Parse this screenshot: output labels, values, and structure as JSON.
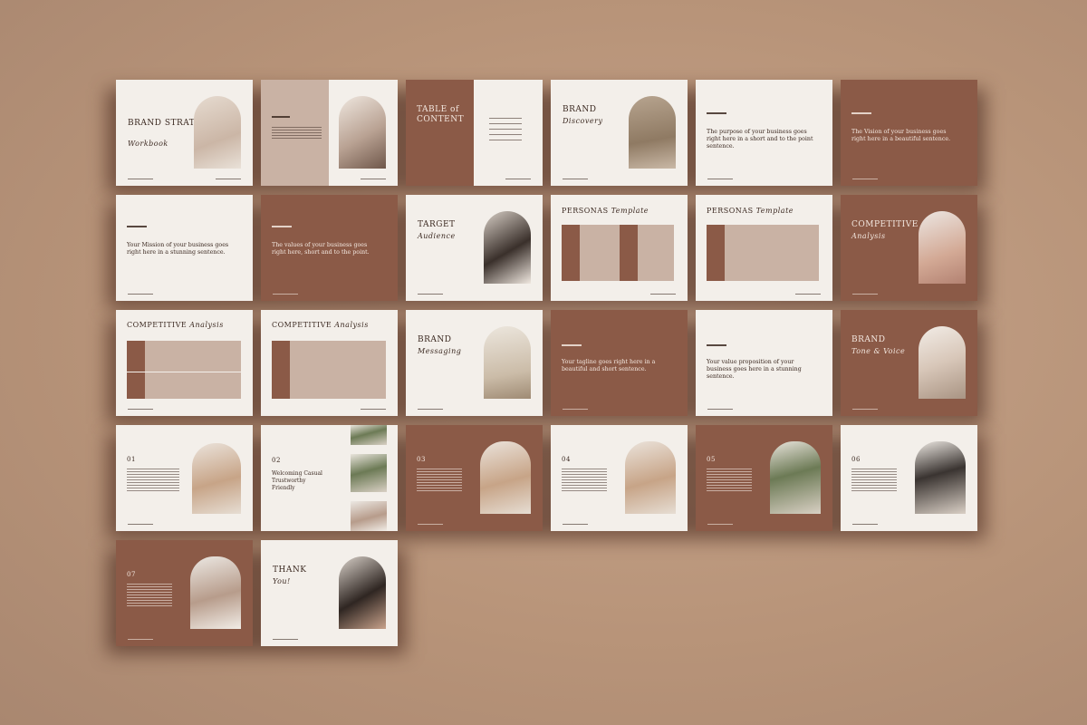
{
  "background_color": "#b89479",
  "slides": [
    {
      "id": 1,
      "title": "BRAND STRATEGY",
      "subtitle": "Workbook"
    },
    {
      "id": 2,
      "title": "",
      "subtitle": ""
    },
    {
      "id": 3,
      "title": "TABLE of CONTENT",
      "subtitle": ""
    },
    {
      "id": 4,
      "title": "BRAND",
      "subtitle": "Discovery"
    },
    {
      "id": 5,
      "title": "",
      "body": "The purpose of your business goes right here in a short and to the point sentence."
    },
    {
      "id": 6,
      "title": "",
      "body": "The Vision of your business goes right here in a beautiful sentence."
    },
    {
      "id": 7,
      "title": "",
      "body": "Your Mission of your business goes right here in a stunning sentence."
    },
    {
      "id": 8,
      "title": "",
      "body": "The values of your business goes right here, short and to the point."
    },
    {
      "id": 9,
      "title": "TARGET",
      "subtitle": "Audience"
    },
    {
      "id": 10,
      "title": "PERSONAS",
      "subtitle": "Template"
    },
    {
      "id": 11,
      "title": "PERSONAS",
      "subtitle": "Template"
    },
    {
      "id": 12,
      "title": "COMPETITIVE",
      "subtitle": "Analysis"
    },
    {
      "id": 13,
      "title": "COMPETITIVE",
      "subtitle": "Analysis"
    },
    {
      "id": 14,
      "title": "COMPETITIVE",
      "subtitle": "Analysis"
    },
    {
      "id": 15,
      "title": "BRAND",
      "subtitle": "Messaging"
    },
    {
      "id": 16,
      "title": "",
      "body": "Your tagline goes right here in a beautiful and short sentence."
    },
    {
      "id": 17,
      "title": "",
      "body": "Your value proposition of your business goes here in a stunning sentence."
    },
    {
      "id": 18,
      "title": "BRAND",
      "subtitle": "Tone & Voice"
    },
    {
      "id": 19,
      "title": "01",
      "subtitle": ""
    },
    {
      "id": 20,
      "title": "02",
      "body": "Welcoming Casual Trustworthy Friendly"
    },
    {
      "id": 21,
      "title": "03",
      "subtitle": ""
    },
    {
      "id": 22,
      "title": "04",
      "subtitle": ""
    },
    {
      "id": 23,
      "title": "05",
      "subtitle": ""
    },
    {
      "id": 24,
      "title": "06",
      "subtitle": ""
    },
    {
      "id": 25,
      "title": "07",
      "subtitle": ""
    },
    {
      "id": 26,
      "title": "THANK",
      "subtitle": "You!"
    }
  ]
}
